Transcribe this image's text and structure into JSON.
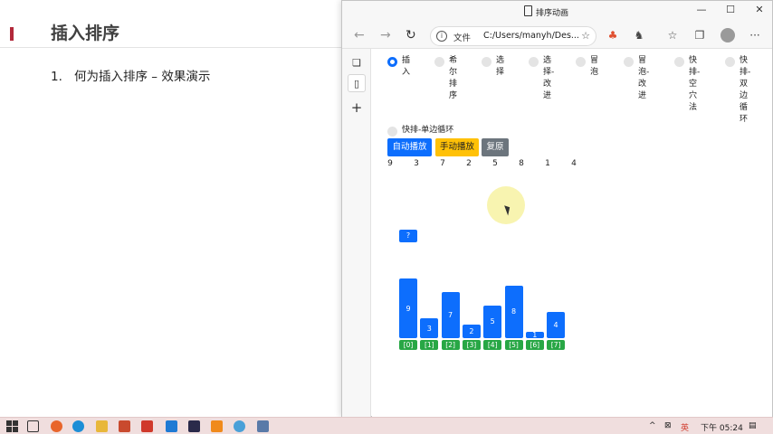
{
  "slide": {
    "title": "插入排序",
    "item_number": "1.",
    "item_text": "何为插入排序 – 效果演示"
  },
  "browser": {
    "tab_title": "排序动画",
    "window_controls": {
      "minimize": "—",
      "maximize": "☐",
      "close": "✕"
    },
    "address_label": "文件",
    "address_url": "C:/Users/manyh/Des...",
    "icons": [
      "back-icon",
      "forward-icon",
      "refresh-icon",
      "info-icon",
      "favorite-add-icon",
      "extension-icon",
      "evernote-icon",
      "favorites-icon",
      "collections-icon",
      "profile-icon",
      "more-icon"
    ]
  },
  "vertical_tabs": {
    "add_label": "+"
  },
  "page": {
    "algorithms": [
      {
        "label": "插入",
        "selected": true
      },
      {
        "label": "希尔排序",
        "selected": false
      },
      {
        "label": "选择",
        "selected": false
      },
      {
        "label": "选择-改进",
        "selected": false
      },
      {
        "label": "冒泡",
        "selected": false
      },
      {
        "label": "冒泡-改进",
        "selected": false
      },
      {
        "label": "快排-空穴法",
        "selected": false
      },
      {
        "label": "快排-双边循环",
        "selected": false
      },
      {
        "label": "快排-单边循环",
        "selected": false
      }
    ],
    "buttons": {
      "auto": "自动播放",
      "manual": "手动播放",
      "reset": "复原"
    },
    "array": [
      "9",
      "3",
      "7",
      "2",
      "5",
      "8",
      "1",
      "4"
    ],
    "temp_label": "?",
    "indices": [
      "[0]",
      "[1]",
      "[2]",
      "[3]",
      "[4]",
      "[5]",
      "[6]",
      "[7]"
    ],
    "colors": {
      "primary": "#0d6efd",
      "warning": "#ffc107",
      "secondary": "#6c757d",
      "success": "#28a745"
    }
  },
  "chart_data": {
    "type": "bar",
    "categories": [
      "[0]",
      "[1]",
      "[2]",
      "[3]",
      "[4]",
      "[5]",
      "[6]",
      "[7]"
    ],
    "values": [
      9,
      3,
      7,
      2,
      5,
      8,
      1,
      4
    ]
  },
  "taskbar": {
    "clock": "下午 05:24",
    "input_method": "英"
  }
}
